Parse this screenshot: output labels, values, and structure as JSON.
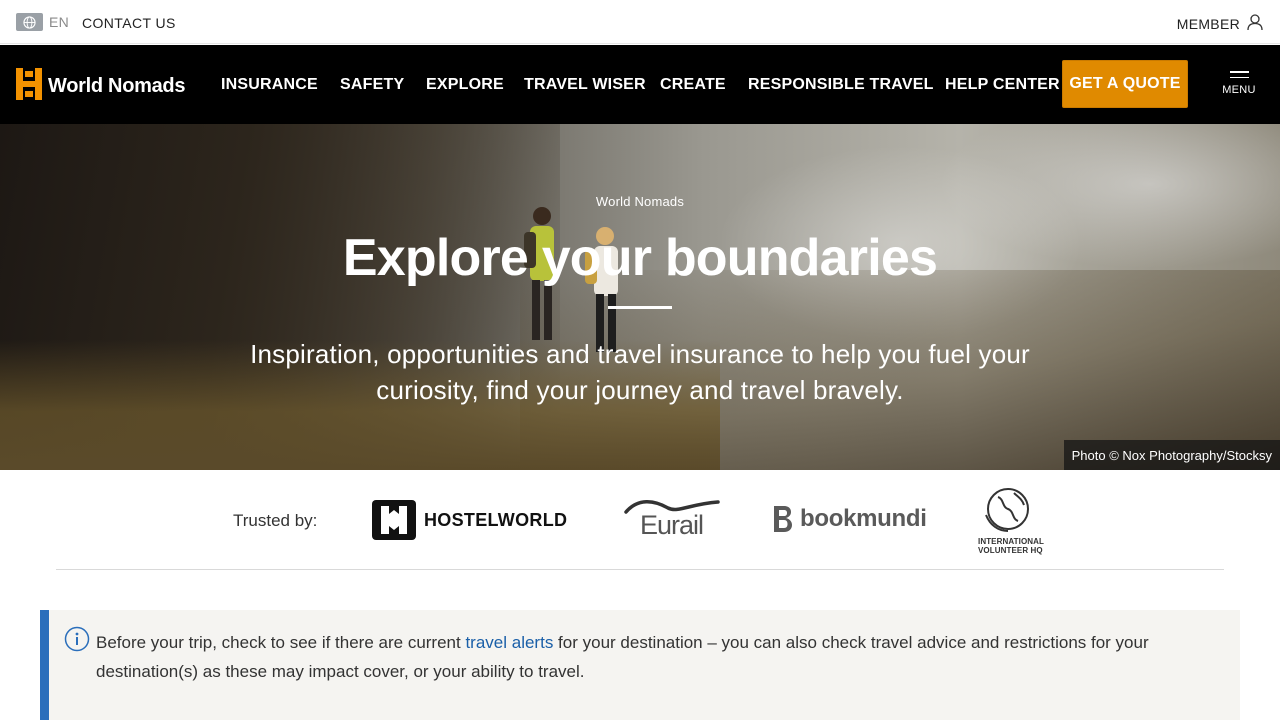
{
  "utility_bar": {
    "language": "EN",
    "contact": "CONTACT US",
    "member": "MEMBER",
    "icons": [
      "globe-icon",
      "user-icon"
    ]
  },
  "navbar": {
    "logo_text": "World Nomads",
    "items": [
      {
        "label": "INSURANCE"
      },
      {
        "label": "SAFETY"
      },
      {
        "label": "EXPLORE"
      },
      {
        "label": "TRAVEL WISER"
      },
      {
        "label": "CREATE"
      },
      {
        "label": "RESPONSIBLE TRAVEL"
      },
      {
        "label": "HELP CENTER"
      }
    ],
    "cta": "GET A QUOTE",
    "menu_label": "MENU"
  },
  "hero": {
    "kicker": "World Nomads",
    "title": "Explore your boundaries",
    "subtitle": "Inspiration, opportunities and travel insurance to help you fuel your curiosity, find your journey and travel bravely.",
    "photo_credit": "Photo © Nox Photography/Stocksy"
  },
  "trusted": {
    "label": "Trusted by:",
    "partners": {
      "hostelworld": "HOSTELWORLD",
      "eurail": "Eurail",
      "bookmundi": "bookmundi",
      "ivhq_line1": "INTERNATIONAL",
      "ivhq_line2": "VOLUNTEER HQ"
    }
  },
  "alert": {
    "text_before": "Before your trip, check to see if there are current ",
    "link": "travel alerts",
    "text_after": " for your destination – you can also check travel advice and restrictions for your destination(s) as these may impact cover, or your ability to travel."
  },
  "colors": {
    "accent": "#e08a00",
    "nav_bg": "#000000",
    "link": "#1a5fa8",
    "alert_border": "#2a6ebb",
    "alert_bg": "#f5f4f1"
  }
}
